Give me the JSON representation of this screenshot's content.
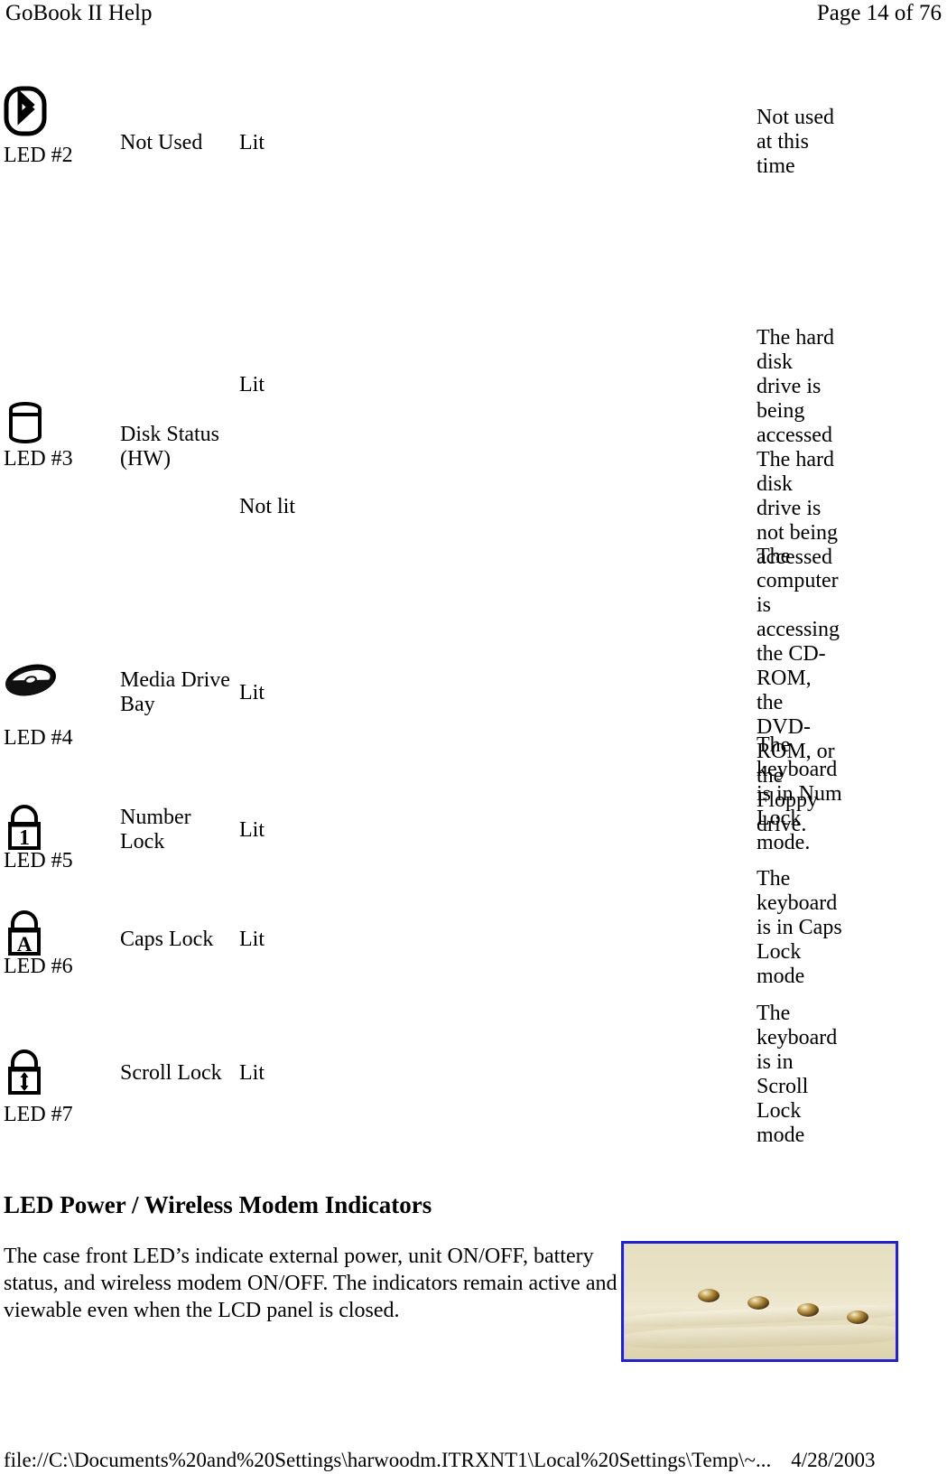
{
  "header": {
    "title": "GoBook II Help",
    "page_label": "Page 14 of 76"
  },
  "led_table": {
    "rows": [
      {
        "icon": "bluetooth-icon",
        "led_label": "LED #2",
        "name": "Not Used",
        "states": [
          {
            "state": "Lit",
            "description": "Not used at this time"
          }
        ]
      },
      {
        "icon": "disk-drive-icon",
        "led_label": "LED #3",
        "name": "Disk Status (HW)",
        "states": [
          {
            "state": "Lit",
            "description": "The hard disk drive is being accessed"
          },
          {
            "state": "Not lit",
            "description": "The hard disk drive is not being accessed"
          }
        ]
      },
      {
        "icon": "optical-disc-icon",
        "led_label": "LED #4",
        "name": "Media Drive Bay",
        "states": [
          {
            "state": "Lit",
            "description": "The computer is accessing the CD-ROM, the DVD-ROM, or the Floppy drive."
          }
        ]
      },
      {
        "icon": "num-lock-icon",
        "led_label": "LED #5",
        "name": "Number Lock",
        "states": [
          {
            "state": "Lit",
            "description": "The keyboard is in Num Lock mode."
          }
        ]
      },
      {
        "icon": "caps-lock-icon",
        "led_label": "LED #6",
        "name": "Caps Lock",
        "states": [
          {
            "state": "Lit",
            "description": "The keyboard is in Caps Lock mode"
          }
        ]
      },
      {
        "icon": "scroll-lock-icon",
        "led_label": "LED #7",
        "name": "Scroll Lock",
        "states": [
          {
            "state": "Lit",
            "description": "The keyboard is in Scroll Lock mode"
          }
        ]
      }
    ]
  },
  "section": {
    "heading": "LED Power / Wireless Modem Indicators",
    "paragraph": "The case front LED’s indicate external power, unit ON/OFF, battery status, and wireless modem ON/OFF.  The indicators remain active and viewable even when the LCD panel is closed."
  },
  "photo": {
    "alt": "case-front-led-indicators-photo",
    "border_color": "#2222cc",
    "surface_color": "#e6dfc2"
  },
  "footer": {
    "path": "file://C:\\Documents%20and%20Settings\\harwoodm.ITRXNT1\\Local%20Settings\\Temp\\~...",
    "date": "4/28/2003"
  }
}
